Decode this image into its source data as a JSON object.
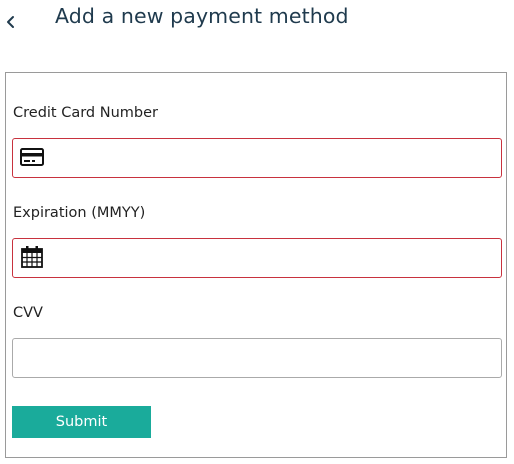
{
  "header": {
    "back_icon": "chevron-left-icon",
    "title": "Add a new payment method"
  },
  "form": {
    "card_number": {
      "label": "Credit Card Number",
      "value": "",
      "icon": "credit-card-icon",
      "state": "invalid"
    },
    "expiration": {
      "label": "Expiration (MMYY)",
      "value": "",
      "icon": "calendar-icon",
      "state": "invalid"
    },
    "cvv": {
      "label": "CVV",
      "value": ""
    },
    "submit_label": "Submit"
  },
  "colors": {
    "title": "#1f3a4d",
    "error_border": "#c8323e",
    "submit_background": "#1aab9b",
    "submit_text": "#ffffff",
    "panel_border": "#9a9a9a"
  }
}
